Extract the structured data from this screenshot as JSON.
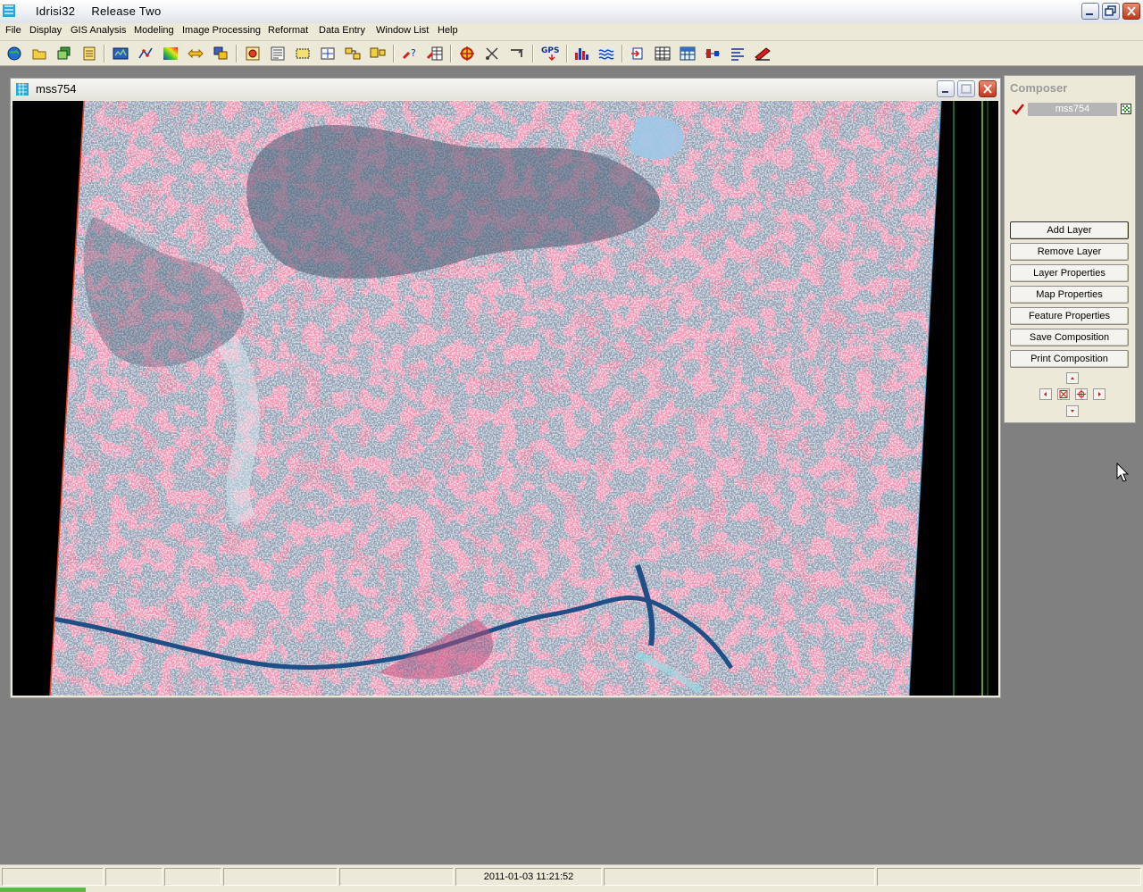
{
  "window": {
    "app_name": "Idrisi32",
    "release": "Release Two"
  },
  "menu": [
    "File",
    "Display",
    "GIS Analysis",
    "Modeling",
    "Image Processing",
    "Reformat",
    "Data Entry",
    "Window List",
    "Help"
  ],
  "toolbar_icons": [
    "globe-icon",
    "open-folder-icon",
    "layers-icon",
    "list-icon",
    "display-map-icon",
    "vectorize-icon",
    "palette-icon",
    "swap-icon",
    "window-icon",
    "zoom-icon",
    "text-layout-icon",
    "select-region-icon",
    "crosshair-box-icon",
    "group-icon",
    "resample-icon",
    "query-icon",
    "spreadsheet-query-icon",
    "target-icon",
    "digitize-icon",
    "rubber-icon",
    "gps-icon",
    "histogram-icon",
    "waves-icon",
    "import-icon",
    "table-icon",
    "grid-icon",
    "profile-icon",
    "align-icon",
    "style-icon"
  ],
  "toolbar_gps_label": "GPS",
  "image_window": {
    "title": "mss754"
  },
  "composer": {
    "title": "Composer",
    "layer": "mss754",
    "buttons": {
      "add_layer": "Add Layer",
      "remove_layer": "Remove Layer",
      "layer_properties": "Layer Properties",
      "map_properties": "Map Properties",
      "feature_properties": "Feature Properties",
      "save_composition": "Save Composition",
      "print_composition": "Print Composition"
    }
  },
  "status": {
    "timestamp": "2011-01-03 11:21:52"
  },
  "colors": {
    "desktop": "#808080",
    "imagery_pink": "#d98aa7",
    "imagery_forest": "#4a5a72",
    "imagery_water": "#27508a",
    "close_button": "#c0391c"
  }
}
